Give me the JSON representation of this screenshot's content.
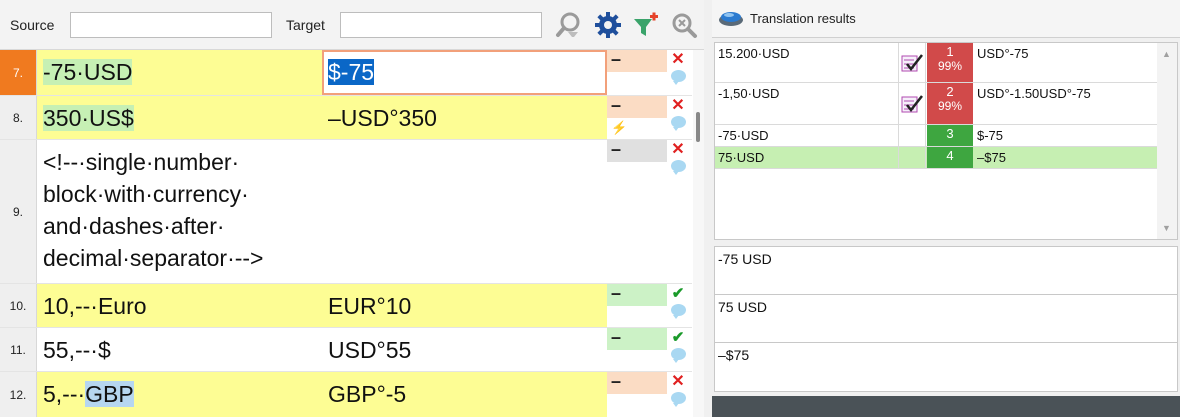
{
  "filter": {
    "source_label": "Source",
    "target_label": "Target",
    "source_value": "",
    "target_value": ""
  },
  "icons": {
    "search_clear": "magnifier-filter-icon",
    "settings": "gear-icon",
    "add_filter": "funnel-plus-icon",
    "zoom": "zoom-icon"
  },
  "rows": [
    {
      "num": "7.",
      "source": "-75·USD",
      "target": "$-75",
      "status": "–"
    },
    {
      "num": "8.",
      "source": "350·US$",
      "target": "–USD°350",
      "status": "–"
    },
    {
      "num": "9.",
      "source_lines": [
        "<!--·single·number·",
        "block·with·currency·",
        "and·dashes·after·",
        "decimal·separator·-->"
      ],
      "target": "",
      "status": "–"
    },
    {
      "num": "10.",
      "source": "10,--·Euro",
      "target": "EUR°10",
      "status": "–"
    },
    {
      "num": "11.",
      "source": "55,--·$",
      "target": "USD°55",
      "status": "–"
    },
    {
      "num": "12.",
      "source_pre": "5,--·",
      "source_hl": "GBP",
      "target": "GBP°-5",
      "status": "–"
    }
  ],
  "translation": {
    "title": "Translation results",
    "results": [
      {
        "source": "15.200·USD",
        "num": "1",
        "pct": "99%",
        "target": "USD°-75"
      },
      {
        "source": "-1,50·USD",
        "num": "2",
        "pct": "99%",
        "target": "USD°-1.50USD°-75"
      },
      {
        "source": "-75·USD",
        "num": "3",
        "pct": "",
        "target": "$-75"
      },
      {
        "source": "75·USD",
        "num": "4",
        "pct": "",
        "target": "–$75"
      }
    ],
    "compare": [
      "-75 USD",
      "75 USD",
      "–$75"
    ]
  },
  "colors": {
    "active_row": "#f07a1f",
    "match_red": "#d14a4a",
    "match_green": "#3ea640",
    "highlight_green": "#c6efb2"
  }
}
